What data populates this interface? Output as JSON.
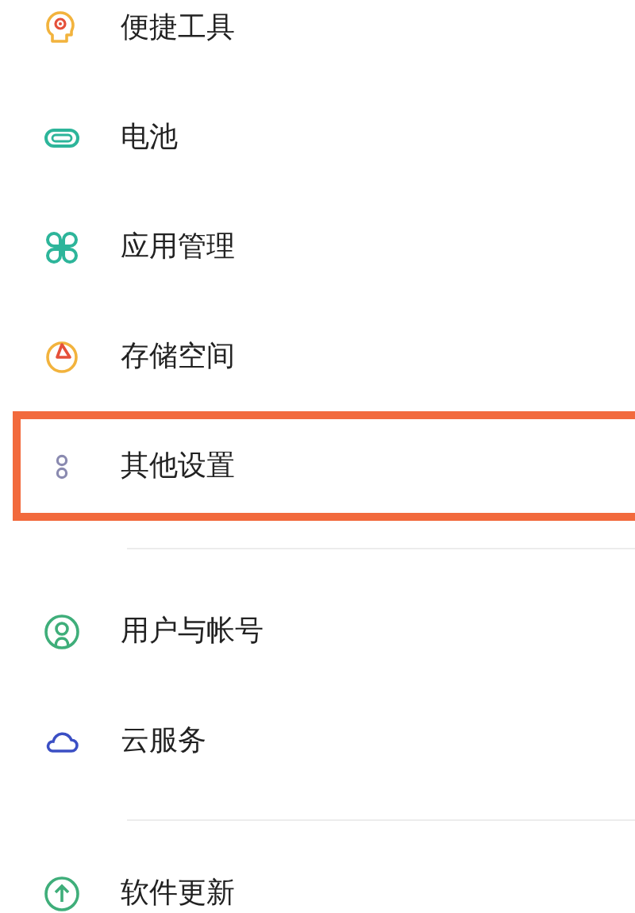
{
  "groups": [
    {
      "items": [
        {
          "label": "便捷工具",
          "kind": "tools",
          "highlighted": false
        },
        {
          "label": "电池",
          "kind": "battery",
          "highlighted": false
        },
        {
          "label": "应用管理",
          "kind": "apps",
          "highlighted": false
        },
        {
          "label": "存储空间",
          "kind": "storage",
          "highlighted": false
        },
        {
          "label": "其他设置",
          "kind": "other",
          "highlighted": true
        }
      ]
    },
    {
      "items": [
        {
          "label": "用户与帐号",
          "kind": "user",
          "highlighted": false
        },
        {
          "label": "云服务",
          "kind": "cloud",
          "highlighted": false
        }
      ]
    },
    {
      "items": [
        {
          "label": "软件更新",
          "kind": "update",
          "highlighted": false
        }
      ]
    }
  ]
}
